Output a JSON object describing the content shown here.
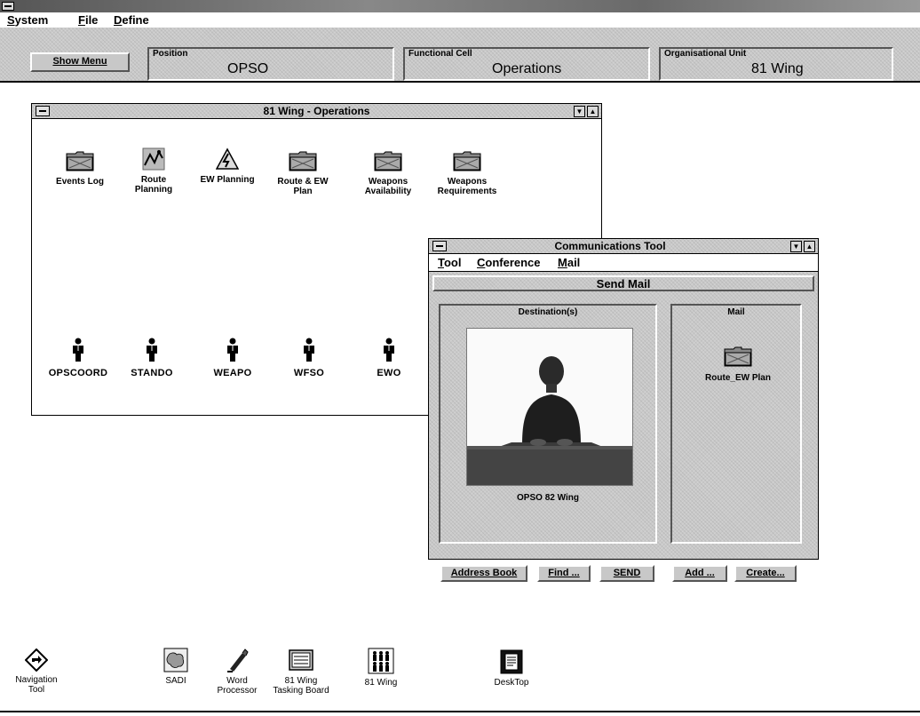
{
  "menubar": {
    "items": [
      "System",
      "File",
      "Define"
    ]
  },
  "toolstrip": {
    "show_menu_label": "Show Menu",
    "position": {
      "label": "Position",
      "value": "OPSO"
    },
    "functional_cell": {
      "label": "Functional Cell",
      "value": "Operations"
    },
    "organisational_unit": {
      "label": "Organisational Unit",
      "value": "81 Wing"
    }
  },
  "group_window": {
    "title": "81 Wing - Operations",
    "apps": [
      {
        "label": "Events Log",
        "icon": "folder-icon"
      },
      {
        "label": "Route\nPlanning",
        "icon": "route-map-icon"
      },
      {
        "label": "EW Planning",
        "icon": "ew-planning-icon"
      },
      {
        "label": "Route & EW\nPlan",
        "icon": "folder-icon"
      },
      {
        "label": "Weapons\nAvailability",
        "icon": "folder-icon"
      },
      {
        "label": "Weapons\nRequirements",
        "icon": "folder-icon"
      }
    ],
    "people": [
      "OPSCOORD",
      "STANDO",
      "WEAPO",
      "WFSO",
      "EWO"
    ]
  },
  "comm_tool": {
    "title": "Communications Tool",
    "menu": [
      "Tool",
      "Conference",
      "Mail"
    ],
    "header": "Send Mail",
    "destination_title": "Destination(s)",
    "destination_name": "OPSO 82 Wing",
    "mail_title": "Mail",
    "mail_item": "Route_EW Plan",
    "buttons": {
      "address_book": "Address Book",
      "find": "Find ...",
      "send": "SEND",
      "add": "Add ...",
      "create": "Create..."
    }
  },
  "desktop_icons": [
    {
      "label": "Navigation\nTool",
      "icon": "navigation-icon"
    },
    {
      "label": "SADI",
      "icon": "map-icon"
    },
    {
      "label": "Word\nProcessor",
      "icon": "pen-icon"
    },
    {
      "label": "81 Wing\nTasking Board",
      "icon": "board-icon"
    },
    {
      "label": "81 Wing",
      "icon": "people-icon"
    },
    {
      "label": "DeskTop",
      "icon": "desktop-icon"
    }
  ]
}
